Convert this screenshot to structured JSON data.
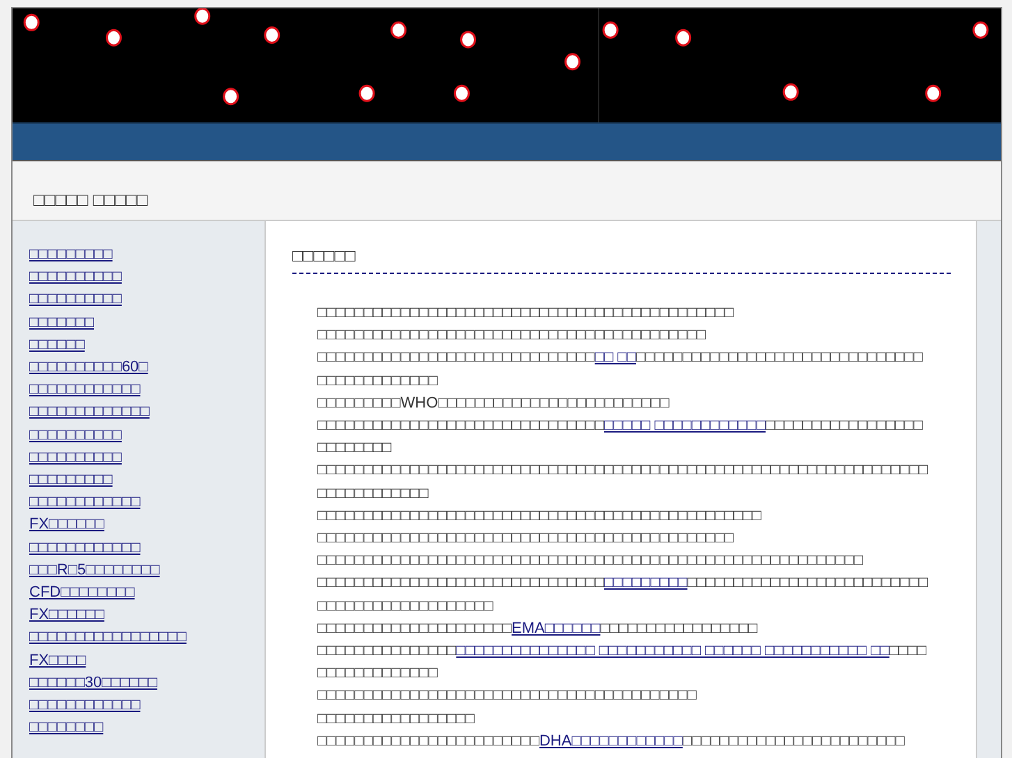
{
  "site_title": "□□□□□ □□□□□",
  "sidebar": {
    "links": [
      "□□□□□□□□□",
      "□□□□□□□□□□",
      "□□□□□□□□□□",
      "□□□□□□□",
      "□□□□□□",
      "□□□□□□□□□□60□",
      "□□□□□□□□□□□□",
      "□□□□□□□□□□□□□",
      "□□□□□□□□□□",
      "□□□□□□□□□□",
      "□□□□□□□□□",
      "□□□□□□□□□□□□",
      "FX□□□□□□",
      "□□□□□□□□□□□□",
      "□□□R□5□□□□□□□□",
      "CFD□□□□□□□□",
      "FX□□□□□□",
      "□□□□□□□□□□□□□□□□□",
      "FX□□□□",
      "□□□□□□30□□□□□□",
      "□□□□□□□□□□□□",
      "□□□□□□□□"
    ]
  },
  "article": {
    "title": "□□□□□□",
    "paragraphs": [
      [
        {
          "kind": "text",
          "text": "□□□□□□□□□□□□□□□□□□□□□□□□□□□□□□□□□□□□□□□□□□□□□"
        }
      ],
      [
        {
          "kind": "text",
          "text": "□□□□□□□□□□□□□□□□□□□□□□□□□□□□□□□□□□□□□□□□□□"
        }
      ],
      [
        {
          "kind": "text",
          "text": "□□□□□□□□□□□□□□□□□□□□□□□□□□□□□□"
        },
        {
          "kind": "link",
          "text": "□□ □□"
        },
        {
          "kind": "text",
          "text": "□□□□□□□□□□□□□□□□□□□□□□□□□□□□□□□□□□□□□□□□□□□□"
        }
      ],
      [
        {
          "kind": "text",
          "text": "□□□□□□□□□"
        },
        {
          "kind": "text",
          "text": "WHO"
        },
        {
          "kind": "text",
          "text": "□□□□□□□□□□□□□□□□□□□□□□□□□"
        }
      ],
      [
        {
          "kind": "text",
          "text": "□□□□□□□□□□□□□□□□□□□□□□□□□□□□□□□"
        },
        {
          "kind": "link",
          "text": "□□□□□ □□□□□□□□□□□□"
        },
        {
          "kind": "text",
          "text": "□□□□□□□□□□□□□□□□□□□□□□□□□"
        }
      ],
      [
        {
          "kind": "text",
          "text": "□□□□□□□□□□□□□□□□□□□□□□□□□□□□□□□□□□□□□□□□□□□□□□□□□□□□□□□□□□□□□□□□□□□□□□□□□□□□□□"
        }
      ],
      [
        {
          "kind": "text",
          "text": "□□□□□□□□□□□□□□□□□□□□□□□□□□□□□□□□□□□□□□□□□□□□□□□□"
        }
      ],
      [
        {
          "kind": "text",
          "text": "□□□□□□□□□□□□□□□□□□□□□□□□□□□□□□□□□□□□□□□□□□□□□"
        }
      ],
      [
        {
          "kind": "text",
          "text": "□□□□□□□□□□□□□□□□□□□□□□□□□□□□□□□□□□□□□□□□□□□□□□□□□□□□□□□□□□□"
        }
      ],
      [
        {
          "kind": "text",
          "text": "□□□□□□□□□□□□□□□□□□□□□□□□□□□□□□□"
        },
        {
          "kind": "link",
          "text": "□□□□□□□□□"
        },
        {
          "kind": "text",
          "text": "□□□□□□□□□□□□□□□□□□□□□□□□□□□□□□□□□□□□□□□□□□□□□"
        }
      ],
      [
        {
          "kind": "text",
          "text": "□□□□□□□□□□□□□□□□□□□□□"
        },
        {
          "kind": "link",
          "text": "EMA□□□□□□"
        },
        {
          "kind": "text",
          "text": "□□□□□□□□□□□□□□□□□"
        }
      ],
      [
        {
          "kind": "text",
          "text": "□□□□□□□□□□□□□□□"
        },
        {
          "kind": "link",
          "text": "□□□□□□□□□□□□□□□ □□□□□□□□□□□ □□□□□□ □□□□□□□□□□□ □□"
        },
        {
          "kind": "text",
          "text": "□□□□□□□□□□□□□□□□□"
        }
      ],
      [
        {
          "kind": "text",
          "text": "□□□□□□□□□□□□□□□□□□□□□□□□□□□□□□□□□□□□□□□□□"
        }
      ],
      [
        {
          "kind": "text",
          "text": "□□□□□□□□□□□□□□□□□"
        }
      ],
      [
        {
          "kind": "text",
          "text": "□□□□□□□□□□□□□□□□□□□□□□□□"
        },
        {
          "kind": "link",
          "text": "DHA□□□□□□□□□□□□"
        },
        {
          "kind": "text",
          "text": "□□□□□□□□□□□□□□□□□□□□□□□□"
        }
      ]
    ]
  }
}
